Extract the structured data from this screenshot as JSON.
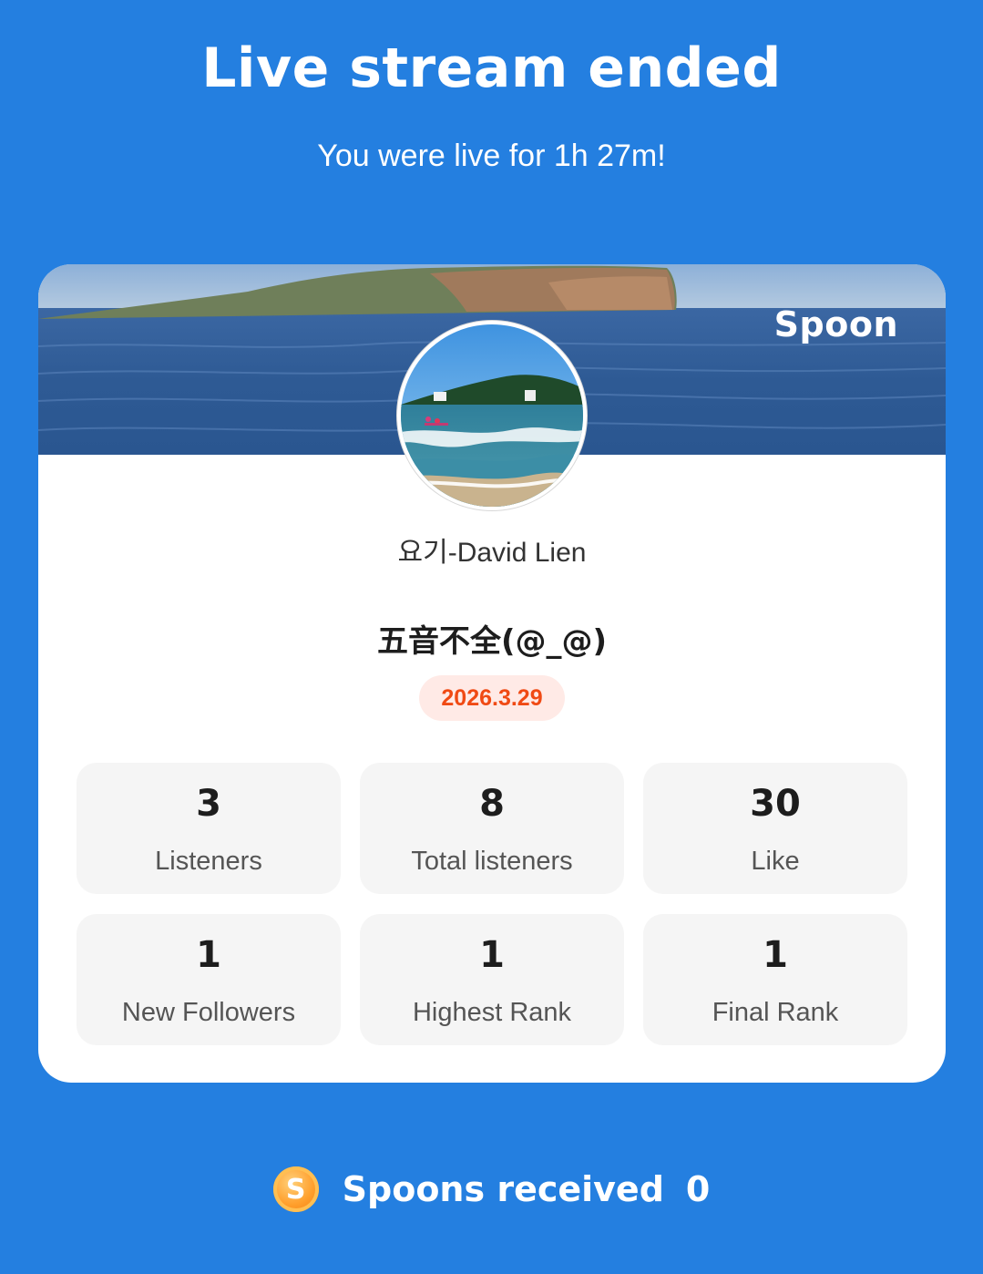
{
  "header": {
    "title": "Live stream ended",
    "subtitle": "You were live for 1h 27m!"
  },
  "card": {
    "brand": "Spoon",
    "host_name": "요기-David Lien",
    "stream_title": "五音不全(@_@)",
    "date": "2026.3.29",
    "stats": [
      {
        "value": "3",
        "label": "Listeners"
      },
      {
        "value": "8",
        "label": "Total listeners"
      },
      {
        "value": "30",
        "label": "Like"
      },
      {
        "value": "1",
        "label": "New Followers"
      },
      {
        "value": "1",
        "label": "Highest Rank"
      },
      {
        "value": "1",
        "label": "Final Rank"
      }
    ]
  },
  "footer": {
    "coin_letter": "S",
    "label": "Spoons received",
    "count": "0"
  },
  "colors": {
    "background": "#247fe0",
    "card": "#ffffff",
    "date_badge_bg": "#ffeae6",
    "date_badge_text": "#f04a14",
    "stat_bg": "#f5f5f5"
  },
  "icons": {
    "coin": "spoon-coin-icon"
  }
}
